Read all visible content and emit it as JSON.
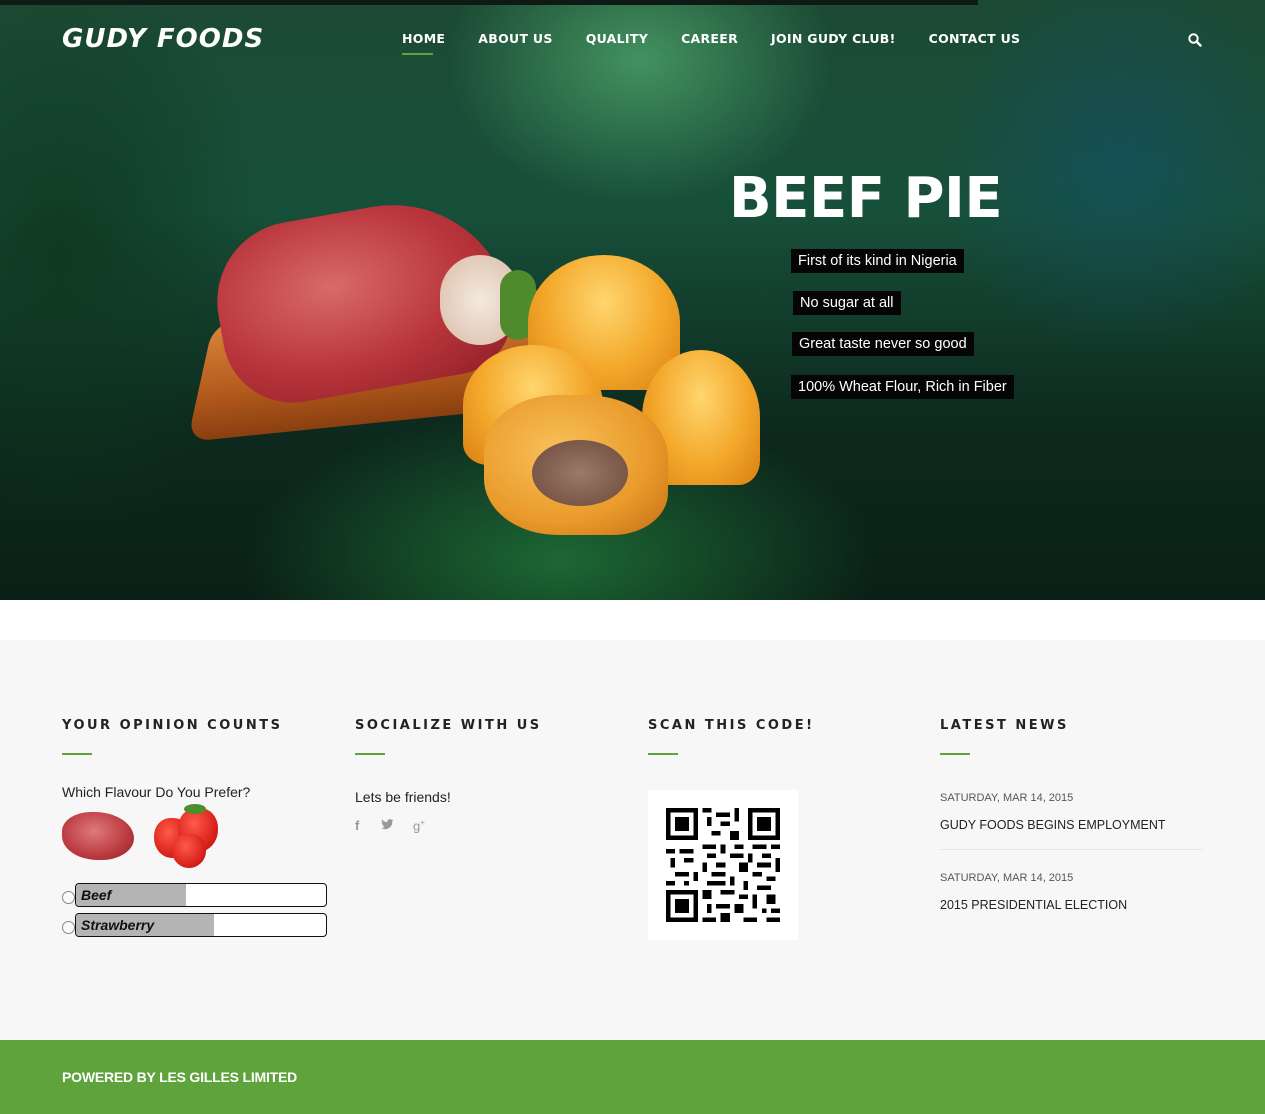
{
  "brand": {
    "logo_text": "GUDY FOODS",
    "accent_color": "#5ea33b"
  },
  "nav": {
    "items": [
      {
        "label": "HOME",
        "active": true
      },
      {
        "label": "ABOUT US",
        "active": false
      },
      {
        "label": "QUALITY",
        "active": false
      },
      {
        "label": "CAREER",
        "active": false
      },
      {
        "label": "JOIN GUDY CLUB!",
        "active": false
      },
      {
        "label": "CONTACT US",
        "active": false
      }
    ],
    "search_icon": "search-icon"
  },
  "hero": {
    "title": "BEEF PIE",
    "features": [
      "First of its kind in Nigeria",
      "No sugar at all",
      "Great taste never so good",
      "100% Wheat Flour, Rich in Fiber"
    ]
  },
  "widgets": {
    "poll": {
      "title": "YOUR OPINION COUNTS",
      "question": "Which Flavour Do You Prefer?",
      "options": [
        {
          "label": "Beef",
          "fraction": 0.44
        },
        {
          "label": "Strawberry",
          "fraction": 0.55
        }
      ]
    },
    "social": {
      "title": "SOCIALIZE WITH US",
      "text": "Lets be friends!",
      "icons": [
        "facebook-icon",
        "twitter-icon",
        "google-plus-icon"
      ]
    },
    "qr": {
      "title": "SCAN THIS CODE!"
    },
    "news": {
      "title": "LATEST NEWS",
      "items": [
        {
          "date": "SATURDAY, MAR 14, 2015",
          "title": "GUDY FOODS BEGINS EMPLOYMENT"
        },
        {
          "date": "SATURDAY, MAR 14, 2015",
          "title": "2015 PRESIDENTIAL ELECTION"
        }
      ]
    }
  },
  "footer": {
    "text": "POWERED BY LES GILLES LIMITED"
  }
}
